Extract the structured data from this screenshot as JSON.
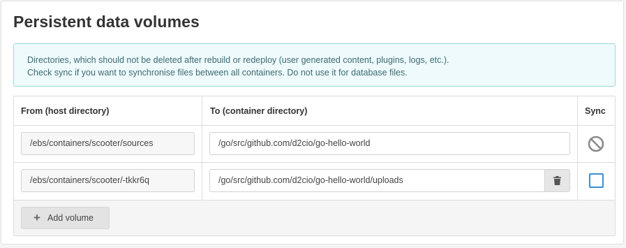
{
  "title": "Persistent data volumes",
  "info": {
    "line1": "Directories, which should not be deleted after rebuild or redeploy (user generated content, plugins, logs, etc.).",
    "line2": "Check sync if you want to synchronise files between all containers. Do not use it for database files."
  },
  "table": {
    "headers": {
      "from": "From (host directory)",
      "to": "To (container directory)",
      "sync": "Sync"
    },
    "rows": [
      {
        "from": "/ebs/containers/scooter/sources",
        "to": "/go/src/github.com/d2cio/go-hello-world",
        "sync_state": "disabled",
        "sync_icon": "ban-icon"
      },
      {
        "from": "/ebs/containers/scooter/-tkkr6q",
        "to": "/go/src/github.com/d2cio/go-hello-world/uploads",
        "sync_state": "unchecked",
        "delete_icon": "trash-icon"
      }
    ]
  },
  "add_button": {
    "label": "Add volume",
    "icon": "plus-icon"
  },
  "colors": {
    "info_bg": "#eefafb",
    "info_border": "#9fd8dc",
    "checkbox_accent": "#3b8fd4"
  }
}
